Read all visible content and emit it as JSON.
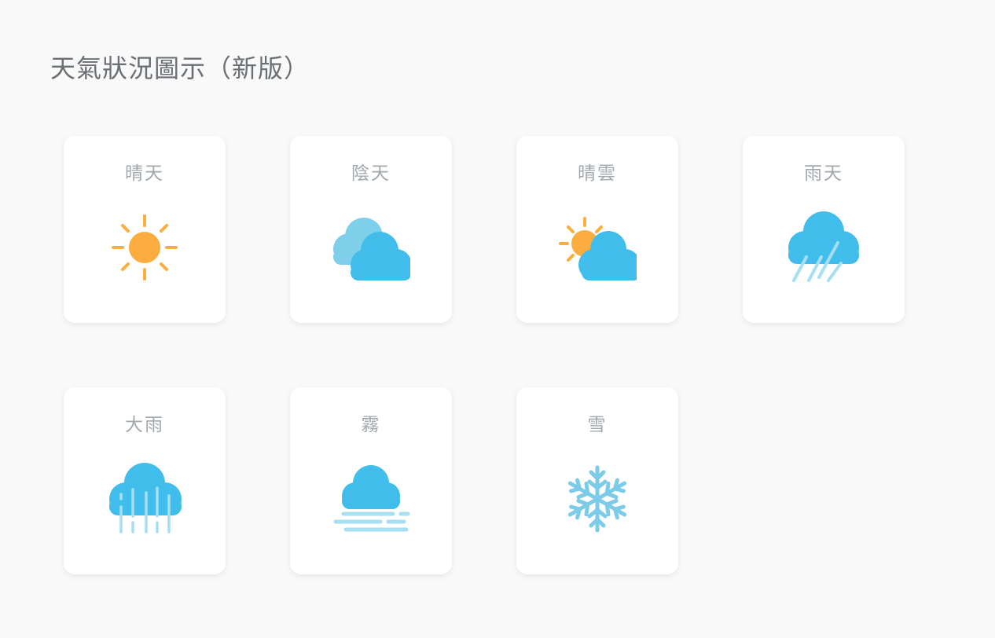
{
  "page": {
    "title": "天氣狀況圖示（新版）"
  },
  "colors": {
    "sun": "#fbad3f",
    "cloud": "#41bdec",
    "cloud_light": "#7dcfea",
    "rain": "#a6def2",
    "snow": "#7ccbe8",
    "background": "#f9f9f9"
  },
  "cards": [
    {
      "label": "晴天",
      "icon": "sun-icon"
    },
    {
      "label": "陰天",
      "icon": "cloudy-icon"
    },
    {
      "label": "晴雲",
      "icon": "partly-cloudy-icon"
    },
    {
      "label": "雨天",
      "icon": "rain-icon"
    },
    {
      "label": "大雨",
      "icon": "heavy-rain-icon"
    },
    {
      "label": "霧",
      "icon": "fog-icon"
    },
    {
      "label": "雪",
      "icon": "snow-icon"
    }
  ]
}
